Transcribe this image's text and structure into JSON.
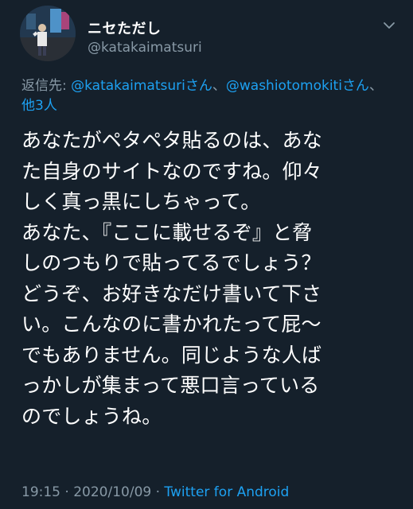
{
  "user": {
    "display_name": "ニセただし",
    "handle": "@katakaimatsuri"
  },
  "reply_to": {
    "label": "返信先: ",
    "mention_1": "@katakaimatsuriさん",
    "separator": "、",
    "mention_2": "@washiotomokiti",
    "mention_2_suffix": "さん",
    "separator_2": "、",
    "others": "他3人"
  },
  "tweet": {
    "lines": [
      "あなたがペタペタ貼るのは、あな",
      "た自身のサイトなのですね。仰々",
      "しく真っ黒にしちゃって。",
      "あなた、『ここに載せるぞ』と脅",
      "しのつもりで貼ってるでしょう？",
      "どうぞ、お好きなだけ書いて下さ",
      "い。こんなのに書かれたって屁〜",
      "でもありません。同じような人ば",
      "っかしが集まって悪口言っている",
      "のでしょうね。"
    ]
  },
  "meta": {
    "time": "19:15",
    "dot": " · ",
    "date": "2020/10/09",
    "dot2": " · ",
    "source": "Twitter for Android"
  },
  "colors": {
    "background": "#15202b",
    "text": "#ffffff",
    "secondary": "#8899a6",
    "accent": "#1da1f2"
  },
  "icons": {
    "caret": "chevron-down-icon"
  }
}
